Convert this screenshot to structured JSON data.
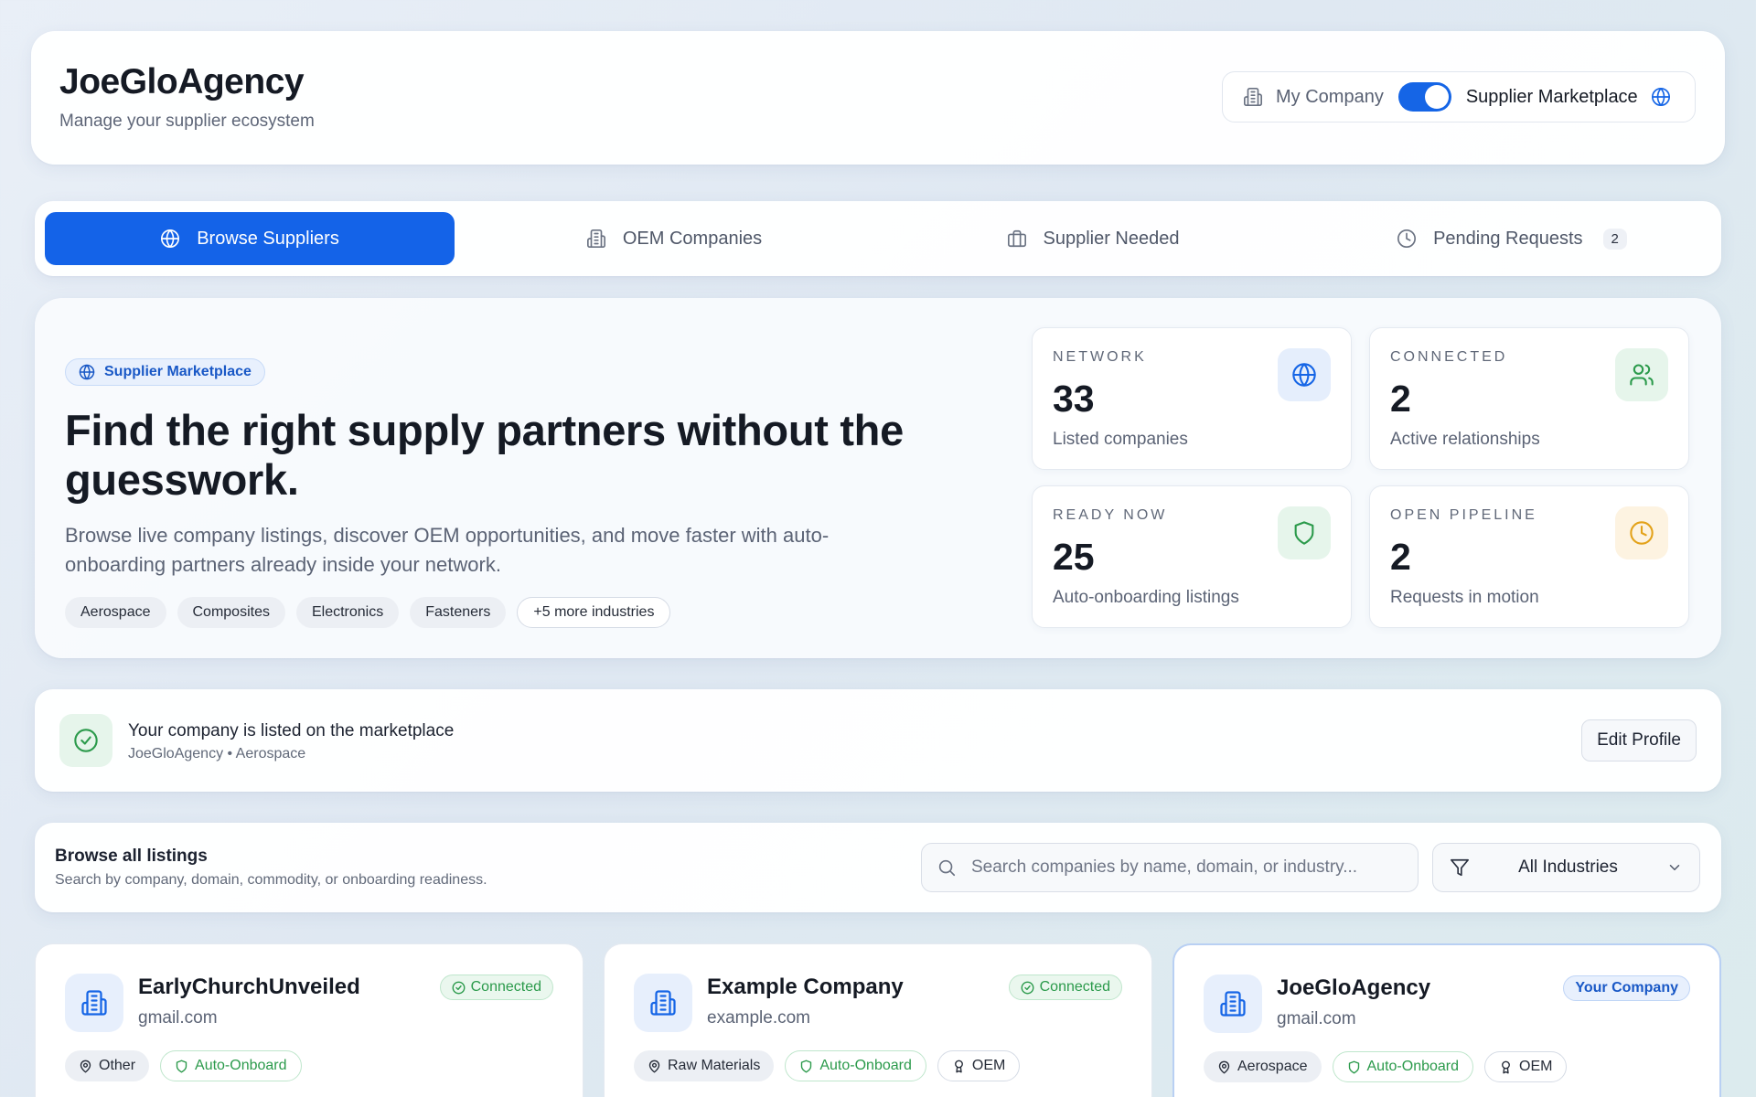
{
  "header": {
    "title": "JoeGloAgency",
    "subtitle": "Manage your supplier ecosystem",
    "switch_left": "My Company",
    "switch_right": "Supplier Marketplace"
  },
  "tabs": [
    {
      "label": "Browse Suppliers",
      "icon": "globe-icon",
      "active": true
    },
    {
      "label": "OEM Companies",
      "icon": "building-icon"
    },
    {
      "label": "Supplier Needed",
      "icon": "briefcase-icon"
    },
    {
      "label": "Pending Requests",
      "icon": "clock-icon",
      "count": "2"
    }
  ],
  "hero": {
    "badge": "Supplier Marketplace",
    "title": "Find the right supply partners without the guesswork.",
    "description": "Browse live company listings, discover OEM opportunities, and move faster with auto-onboarding partners already inside your network.",
    "chips": [
      "Aerospace",
      "Composites",
      "Electronics",
      "Fasteners"
    ],
    "more_chip": "+5 more industries"
  },
  "stats": [
    {
      "key": "NETWORK",
      "value": "33",
      "desc": "Listed companies",
      "icon": "globe-icon",
      "color": "#1565e6"
    },
    {
      "key": "CONNECTED",
      "value": "2",
      "desc": "Active relationships",
      "icon": "users-icon",
      "color": "#2b9a4b"
    },
    {
      "key": "READY NOW",
      "value": "25",
      "desc": "Auto-onboarding listings",
      "icon": "shield-icon",
      "color": "#2b9a4b"
    },
    {
      "key": "OPEN PIPELINE",
      "value": "2",
      "desc": "Requests in motion",
      "icon": "clock-icon",
      "color": "#e3a21a"
    }
  ],
  "listed": {
    "title": "Your company is listed on the marketplace",
    "subtitle": "JoeGloAgency • Aerospace",
    "edit_label": "Edit Profile"
  },
  "browse": {
    "title": "Browse all listings",
    "subtitle": "Search by company, domain, commodity, or onboarding readiness.",
    "search_placeholder": "Search companies by name, domain, or industry...",
    "filter_value": "All Industries"
  },
  "companies": [
    {
      "name": "EarlyChurchUnveiled",
      "domain": "gmail.com",
      "badge": "Connected",
      "industry": "Other",
      "auto": "Auto-Onboard",
      "oem": ""
    },
    {
      "name": "Example Company",
      "domain": "example.com",
      "badge": "Connected",
      "industry": "Raw Materials",
      "auto": "Auto-Onboard",
      "oem": "OEM"
    },
    {
      "name": "JoeGloAgency",
      "domain": "gmail.com",
      "badge": "Your Company",
      "industry": "Aerospace",
      "auto": "Auto-Onboard",
      "oem": "OEM"
    }
  ]
}
